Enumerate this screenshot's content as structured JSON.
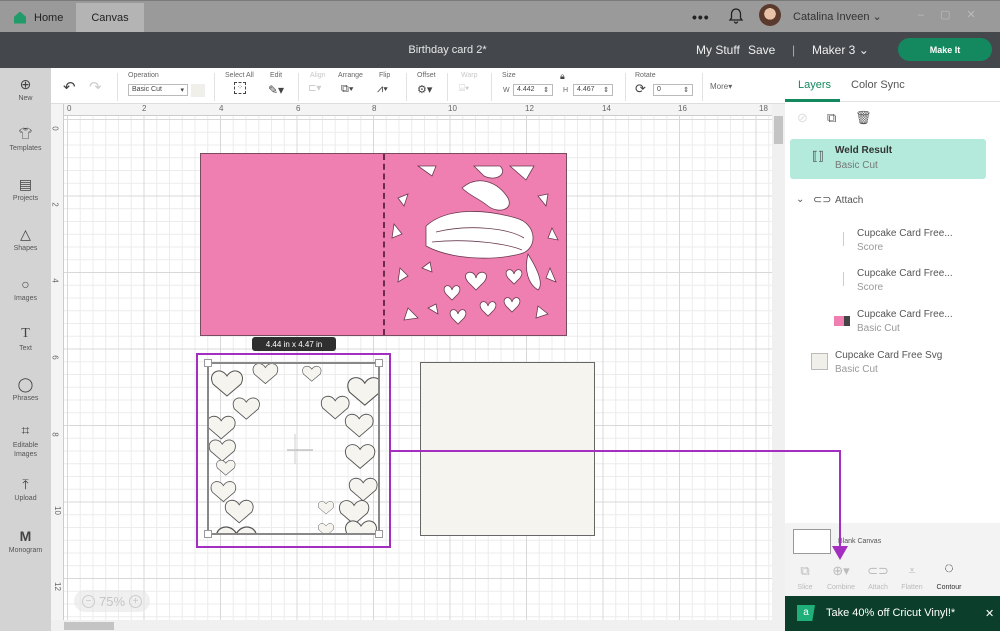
{
  "titlebar": {
    "tabs": [
      {
        "label": "Home",
        "icon": "home-icon"
      },
      {
        "label": "Canvas"
      }
    ],
    "more_label": "•••",
    "user_name": "Catalina Inveen",
    "window_controls": [
      "–",
      "▢",
      "✕"
    ]
  },
  "header": {
    "project_title": "Birthday card 2*",
    "my_stuff": "My Stuff",
    "save": "Save",
    "divider": "|",
    "machine": "Maker 3",
    "make_it": "Make It"
  },
  "sidebar": {
    "items": [
      {
        "label": "New",
        "icon": "⊕"
      },
      {
        "label": "Templates",
        "icon": "👕"
      },
      {
        "label": "Projects",
        "icon": "▤"
      },
      {
        "label": "Shapes",
        "icon": "△"
      },
      {
        "label": "Images",
        "icon": "💡"
      },
      {
        "label": "Text",
        "icon": "T"
      },
      {
        "label": "Phrases",
        "icon": "💬"
      },
      {
        "label": "Editable Images",
        "icon": "⌗"
      },
      {
        "label": "Upload",
        "icon": "⤒"
      },
      {
        "label": "Monogram",
        "icon": "M"
      }
    ]
  },
  "toolbar": {
    "undo": "↶",
    "redo": "↷",
    "operation_label": "Operation",
    "operation_value": "Basic Cut",
    "select_all": "Select All",
    "edit": "Edit",
    "align": "Align",
    "arrange": "Arrange",
    "flip": "Flip",
    "offset": "Offset",
    "warp": "Warp",
    "size_label": "Size",
    "w_label": "W",
    "w_value": "4.442",
    "h_label": "H",
    "h_value": "4.467",
    "rotate_label": "Rotate",
    "rotate_value": "0",
    "more": "More▾"
  },
  "rulers": {
    "top": [
      "0",
      "2",
      "4",
      "6",
      "8",
      "10",
      "12",
      "14",
      "16",
      "18"
    ],
    "left": [
      "0",
      "2",
      "4",
      "6",
      "8",
      "10",
      "12"
    ]
  },
  "canvas": {
    "size_tooltip": "4.44  in x 4.47  in",
    "zoom_level": "75%",
    "zoom_out": "−",
    "zoom_in": "+",
    "colors": {
      "pink": "#f07fb1",
      "cream": "#f6f4ef",
      "selection": "#a42ec0"
    }
  },
  "layers_panel": {
    "tabs": [
      "Layers",
      "Color Sync"
    ],
    "layers": [
      {
        "title": "Weld Result",
        "subtitle": "Basic Cut",
        "selected": true
      },
      {
        "title": "Attach",
        "group": true
      },
      {
        "title": "Cupcake Card Free...",
        "subtitle": "Score"
      },
      {
        "title": "Cupcake Card Free...",
        "subtitle": "Score"
      },
      {
        "title": "Cupcake Card Free...",
        "subtitle": "Basic Cut"
      },
      {
        "title": "Cupcake Card Free Svg",
        "subtitle": "Basic Cut"
      }
    ],
    "blank_canvas": "Blank Canvas",
    "actions": [
      "Slice",
      "Combine",
      "Attach",
      "Flatten",
      "Contour"
    ],
    "promo_text": "Take 40% off Cricut Vinyl!*",
    "promo_close": "✕"
  }
}
